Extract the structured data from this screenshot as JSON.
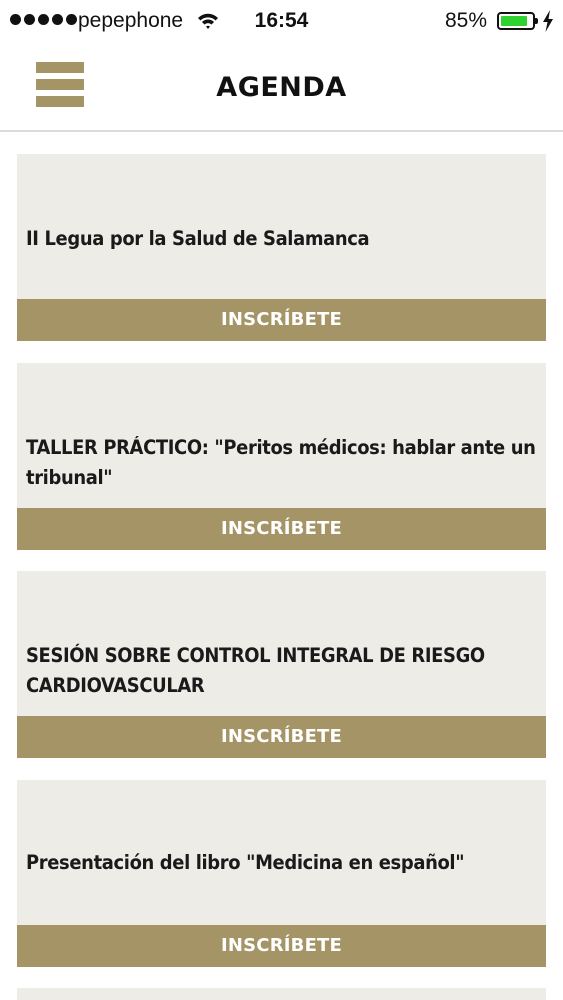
{
  "status_bar": {
    "carrier": "pepephone",
    "time": "16:54",
    "battery_percent": "85%",
    "battery_level": 0.85,
    "battery_color": "#2fd22f"
  },
  "header": {
    "title": "AGENDA",
    "menu_icon": "hamburger-menu-icon"
  },
  "theme": {
    "accent": "#a49466",
    "card_background": "#eeece6"
  },
  "events": [
    {
      "title": "II Legua por la Salud de Salamanca",
      "button_label": "INSCRÍBETE"
    },
    {
      "title": "TALLER PRÁCTICO: \"Peritos médicos: hablar ante un tribunal\"",
      "button_label": "INSCRÍBETE"
    },
    {
      "title": "SESIÓN SOBRE CONTROL INTEGRAL DE RIESGO CARDIOVASCULAR",
      "button_label": "INSCRÍBETE"
    },
    {
      "title": "Presentación del libro \"Medicina en español\"",
      "button_label": "INSCRÍBETE"
    }
  ]
}
